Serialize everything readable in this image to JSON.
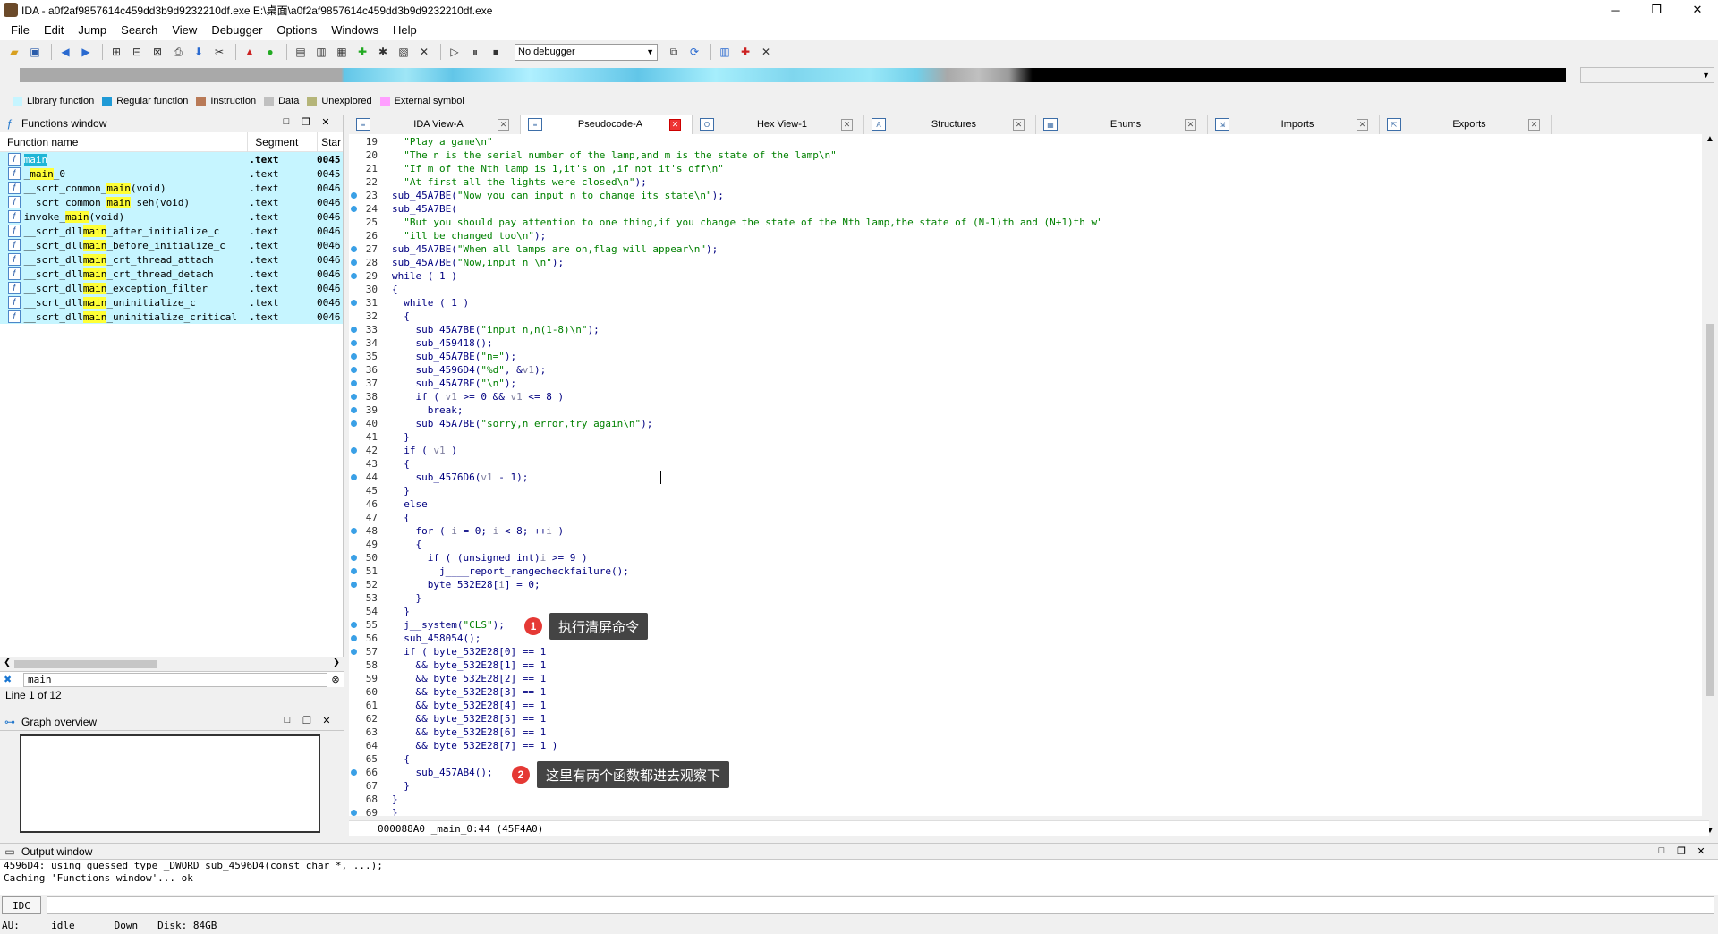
{
  "window": {
    "title": "IDA - a0f2af9857614c459dd3b9d9232210df.exe E:\\桌面\\a0f2af9857614c459dd3b9d9232210df.exe",
    "min": "─",
    "max": "❐",
    "close": "✕"
  },
  "menu": [
    "File",
    "Edit",
    "Jump",
    "Search",
    "View",
    "Debugger",
    "Options",
    "Windows",
    "Help"
  ],
  "toolbar": {
    "debugger_select": "No debugger"
  },
  "legend": [
    {
      "label": "Library function",
      "color": "#c6f5ff"
    },
    {
      "label": "Regular function",
      "color": "#1f9ad6"
    },
    {
      "label": "Instruction",
      "color": "#b97a57"
    },
    {
      "label": "Data",
      "color": "#c0c0c0"
    },
    {
      "label": "Unexplored",
      "color": "#b5b579"
    },
    {
      "label": "External symbol",
      "color": "#ff9fff"
    }
  ],
  "functions": {
    "title": "Functions window",
    "columns": [
      "Function name",
      "Segment",
      "Star"
    ],
    "rows": [
      {
        "pre": "",
        "hl": "main",
        "post": "",
        "seg": ".text",
        "start": "0045",
        "sel": true
      },
      {
        "pre": "_",
        "hl": "main",
        "post": "_0",
        "seg": ".text",
        "start": "0045"
      },
      {
        "pre": "__scrt_common_",
        "hl": "main",
        "post": "(void)",
        "seg": ".text",
        "start": "0046"
      },
      {
        "pre": "__scrt_common_",
        "hl": "main",
        "post": "_seh(void)",
        "seg": ".text",
        "start": "0046"
      },
      {
        "pre": "invoke_",
        "hl": "main",
        "post": "(void)",
        "seg": ".text",
        "start": "0046"
      },
      {
        "pre": "__scrt_dll",
        "hl": "main",
        "post": "_after_initialize_c",
        "seg": ".text",
        "start": "0046"
      },
      {
        "pre": "__scrt_dll",
        "hl": "main",
        "post": "_before_initialize_c",
        "seg": ".text",
        "start": "0046"
      },
      {
        "pre": "__scrt_dll",
        "hl": "main",
        "post": "_crt_thread_attach",
        "seg": ".text",
        "start": "0046"
      },
      {
        "pre": "__scrt_dll",
        "hl": "main",
        "post": "_crt_thread_detach",
        "seg": ".text",
        "start": "0046"
      },
      {
        "pre": "__scrt_dll",
        "hl": "main",
        "post": "_exception_filter",
        "seg": ".text",
        "start": "0046"
      },
      {
        "pre": "__scrt_dll",
        "hl": "main",
        "post": "_uninitialize_c",
        "seg": ".text",
        "start": "0046"
      },
      {
        "pre": "__scrt_dll",
        "hl": "main",
        "post": "_uninitialize_critical",
        "seg": ".text",
        "start": "0046"
      }
    ],
    "search_value": "main",
    "status": "Line 1 of 12"
  },
  "graph": {
    "title": "Graph overview"
  },
  "tabs": [
    "IDA View-A",
    "Pseudocode-A",
    "Hex View-1",
    "Structures",
    "Enums",
    "Imports",
    "Exports"
  ],
  "code": [
    {
      "n": "19",
      "t": "  \"Play a game\\n\"",
      "dot": false
    },
    {
      "n": "20",
      "t": "  \"The n is the serial number of the lamp,and m is the state of the lamp\\n\"",
      "dot": false
    },
    {
      "n": "21",
      "t": "  \"If m of the Nth lamp is 1,it's on ,if not it's off\\n\"",
      "dot": false
    },
    {
      "n": "22",
      "t": "  \"At first all the lights were closed\\n\");",
      "dot": false
    },
    {
      "n": "23",
      "t": "sub_45A7BE(\"Now you can input n to change its state\\n\");",
      "dot": true
    },
    {
      "n": "24",
      "t": "sub_45A7BE(",
      "dot": true
    },
    {
      "n": "25",
      "t": "  \"But you should pay attention to one thing,if you change the state of the Nth lamp,the state of (N-1)th and (N+1)th w\"",
      "dot": false
    },
    {
      "n": "26",
      "t": "  \"ill be changed too\\n\");",
      "dot": false
    },
    {
      "n": "27",
      "t": "sub_45A7BE(\"When all lamps are on,flag will appear\\n\");",
      "dot": true
    },
    {
      "n": "28",
      "t": "sub_45A7BE(\"Now,input n \\n\");",
      "dot": true
    },
    {
      "n": "29",
      "t": "while ( 1 )",
      "dot": true
    },
    {
      "n": "30",
      "t": "{",
      "dot": false
    },
    {
      "n": "31",
      "t": "  while ( 1 )",
      "dot": true
    },
    {
      "n": "32",
      "t": "  {",
      "dot": false
    },
    {
      "n": "33",
      "t": "    sub_45A7BE(\"input n,n(1-8)\\n\");",
      "dot": true
    },
    {
      "n": "34",
      "t": "    sub_459418();",
      "dot": true
    },
    {
      "n": "35",
      "t": "    sub_45A7BE(\"n=\");",
      "dot": true
    },
    {
      "n": "36",
      "t": "    sub_4596D4(\"%d\", &v1);",
      "dot": true
    },
    {
      "n": "37",
      "t": "    sub_45A7BE(\"\\n\");",
      "dot": true
    },
    {
      "n": "38",
      "t": "    if ( v1 >= 0 && v1 <= 8 )",
      "dot": true
    },
    {
      "n": "39",
      "t": "      break;",
      "dot": true
    },
    {
      "n": "40",
      "t": "    sub_45A7BE(\"sorry,n error,try again\\n\");",
      "dot": true
    },
    {
      "n": "41",
      "t": "  }",
      "dot": false
    },
    {
      "n": "42",
      "t": "  if ( v1 )",
      "dot": true
    },
    {
      "n": "43",
      "t": "  {",
      "dot": false
    },
    {
      "n": "44",
      "t": "    sub_4576D6(v1 - 1);",
      "dot": true
    },
    {
      "n": "45",
      "t": "  }",
      "dot": false
    },
    {
      "n": "46",
      "t": "  else",
      "dot": false
    },
    {
      "n": "47",
      "t": "  {",
      "dot": false
    },
    {
      "n": "48",
      "t": "    for ( i = 0; i < 8; ++i )",
      "dot": true
    },
    {
      "n": "49",
      "t": "    {",
      "dot": false
    },
    {
      "n": "50",
      "t": "      if ( (unsigned int)i >= 9 )",
      "dot": true
    },
    {
      "n": "51",
      "t": "        j____report_rangecheckfailure();",
      "dot": true
    },
    {
      "n": "52",
      "t": "      byte_532E28[i] = 0;",
      "dot": true
    },
    {
      "n": "53",
      "t": "    }",
      "dot": false
    },
    {
      "n": "54",
      "t": "  }",
      "dot": false
    },
    {
      "n": "55",
      "t": "  j__system(\"CLS\");",
      "dot": true
    },
    {
      "n": "56",
      "t": "  sub_458054();",
      "dot": true
    },
    {
      "n": "57",
      "t": "  if ( byte_532E28[0] == 1",
      "dot": true
    },
    {
      "n": "58",
      "t": "    && byte_532E28[1] == 1",
      "dot": false
    },
    {
      "n": "59",
      "t": "    && byte_532E28[2] == 1",
      "dot": false
    },
    {
      "n": "60",
      "t": "    && byte_532E28[3] == 1",
      "dot": false
    },
    {
      "n": "61",
      "t": "    && byte_532E28[4] == 1",
      "dot": false
    },
    {
      "n": "62",
      "t": "    && byte_532E28[5] == 1",
      "dot": false
    },
    {
      "n": "63",
      "t": "    && byte_532E28[6] == 1",
      "dot": false
    },
    {
      "n": "64",
      "t": "    && byte_532E28[7] == 1 )",
      "dot": false
    },
    {
      "n": "65",
      "t": "  {",
      "dot": false
    },
    {
      "n": "66",
      "t": "    sub_457AB4();",
      "dot": true
    },
    {
      "n": "67",
      "t": "  }",
      "dot": false
    },
    {
      "n": "68",
      "t": "}",
      "dot": false
    },
    {
      "n": "69",
      "t": "}",
      "dot": true
    }
  ],
  "code_status": "000088A0 _main_0:44 (45F4A0)",
  "annotations": [
    {
      "num": "1",
      "text": "执行清屏命令"
    },
    {
      "num": "2",
      "text": "这里有两个函数都进去观察下"
    }
  ],
  "output": {
    "title": "Output window",
    "lines": [
      "4596D4: using guessed type _DWORD sub_4596D4(const char *, ...);",
      "Caching 'Functions window'... ok"
    ],
    "idc_label": "IDC"
  },
  "status": {
    "au": "AU:",
    "au_value": "idle",
    "direction": "Down",
    "disk": "Disk: 84GB"
  }
}
